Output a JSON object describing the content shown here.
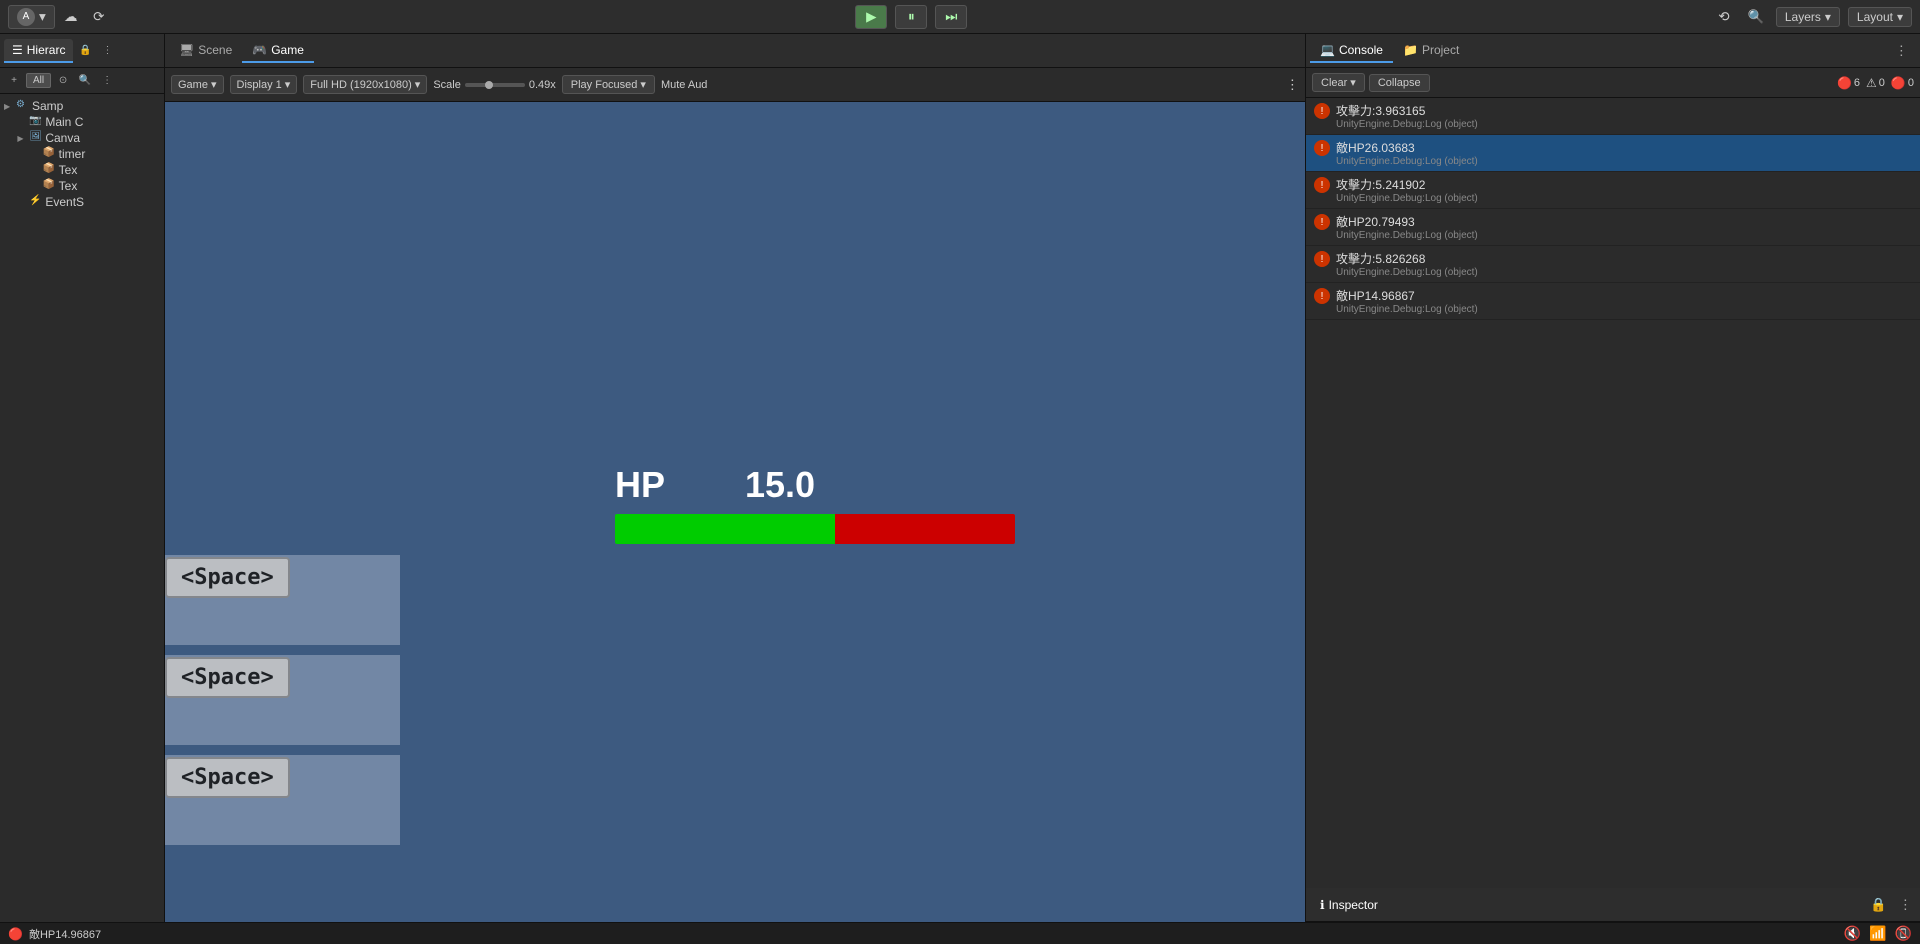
{
  "topbar": {
    "account_label": "A",
    "account_arrow": "▾",
    "cloud_icon": "☁",
    "history_icon": "⟳",
    "play_icon": "▶",
    "pause_icon": "⏸",
    "step_icon": "⏭",
    "search_icon": "🔍",
    "layers_label": "Layers",
    "layers_arrow": "▾",
    "layout_label": "Layout",
    "layout_arrow": "▾"
  },
  "hierarchy": {
    "tab_label": "Hierarc",
    "toolbar": {
      "add_label": "+",
      "all_label": "All",
      "scene_filter_icon": "⊙"
    },
    "items": [
      {
        "label": "Samp",
        "indent": 0,
        "has_arrow": true,
        "icon": "⚙",
        "selected": false
      },
      {
        "label": "Main C",
        "indent": 1,
        "has_arrow": false,
        "icon": "📷",
        "selected": false
      },
      {
        "label": "Canva",
        "indent": 1,
        "has_arrow": true,
        "icon": "🖼",
        "selected": false
      },
      {
        "label": "timer",
        "indent": 2,
        "has_arrow": false,
        "icon": "📦",
        "selected": false
      },
      {
        "label": "Tex",
        "indent": 2,
        "has_arrow": false,
        "icon": "📦",
        "selected": false
      },
      {
        "label": "Tex",
        "indent": 2,
        "has_arrow": false,
        "icon": "📦",
        "selected": false
      },
      {
        "label": "EventS",
        "indent": 1,
        "has_arrow": false,
        "icon": "⚡",
        "selected": false
      }
    ]
  },
  "scene_tab": {
    "label": "Scene",
    "icon": "🖥"
  },
  "game_tab": {
    "label": "Game",
    "icon": "🎮",
    "active": true
  },
  "game_toolbar": {
    "game_dropdown": "Game",
    "display_dropdown": "Display 1",
    "resolution_dropdown": "Full HD (1920x1080)",
    "scale_label": "Scale",
    "scale_value": "0.49x",
    "play_focused_label": "Play Focused",
    "mute_audio_label": "Mute Aud",
    "more_icon": "⋮"
  },
  "game_viewport": {
    "background_color": "#3d5a80",
    "hp_label": "HP",
    "hp_value": "15.0",
    "hp_bar_green_pct": 55,
    "hp_bar_red_pct": 45,
    "space_hints": [
      "<Space>",
      "<Space>",
      "<Space>"
    ]
  },
  "console_panel": {
    "tab_label": "Console",
    "tab_icon": "💻",
    "project_tab_label": "Project",
    "project_tab_icon": "📁",
    "more_icon": "⋮",
    "toolbar": {
      "clear_label": "Clear",
      "clear_arrow": "▾",
      "collapse_label": "Collapse",
      "badge_error_icon": "🔴",
      "badge_error_count": "6",
      "badge_warn_icon": "⚠",
      "badge_warn_count": "0",
      "badge_info_icon": "🔴",
      "badge_info_count": "0"
    },
    "items": [
      {
        "id": 1,
        "main": "攻擊力:3.963165",
        "sub": "UnityEngine.Debug:Log (object)",
        "selected": false
      },
      {
        "id": 2,
        "main": "敵HP26.03683",
        "sub": "UnityEngine.Debug:Log (object)",
        "selected": true
      },
      {
        "id": 3,
        "main": "攻擊力:5.241902",
        "sub": "UnityEngine.Debug:Log (object)",
        "selected": false
      },
      {
        "id": 4,
        "main": "敵HP20.79493",
        "sub": "UnityEngine.Debug:Log (object)",
        "selected": false
      },
      {
        "id": 5,
        "main": "攻擊力:5.826268",
        "sub": "UnityEngine.Debug:Log (object)",
        "selected": false
      },
      {
        "id": 6,
        "main": "敵HP14.96867",
        "sub": "UnityEngine.Debug:Log (object)",
        "selected": false
      }
    ]
  },
  "inspector_panel": {
    "tab_label": "Inspector",
    "tab_icon": "ℹ",
    "lock_icon": "🔒",
    "more_icon": "⋮"
  },
  "status_bar": {
    "icon": "🔴",
    "text": "敵HP14.96867",
    "icon_1": "🔇",
    "icon_2": "📶",
    "icon_3": "📵"
  }
}
